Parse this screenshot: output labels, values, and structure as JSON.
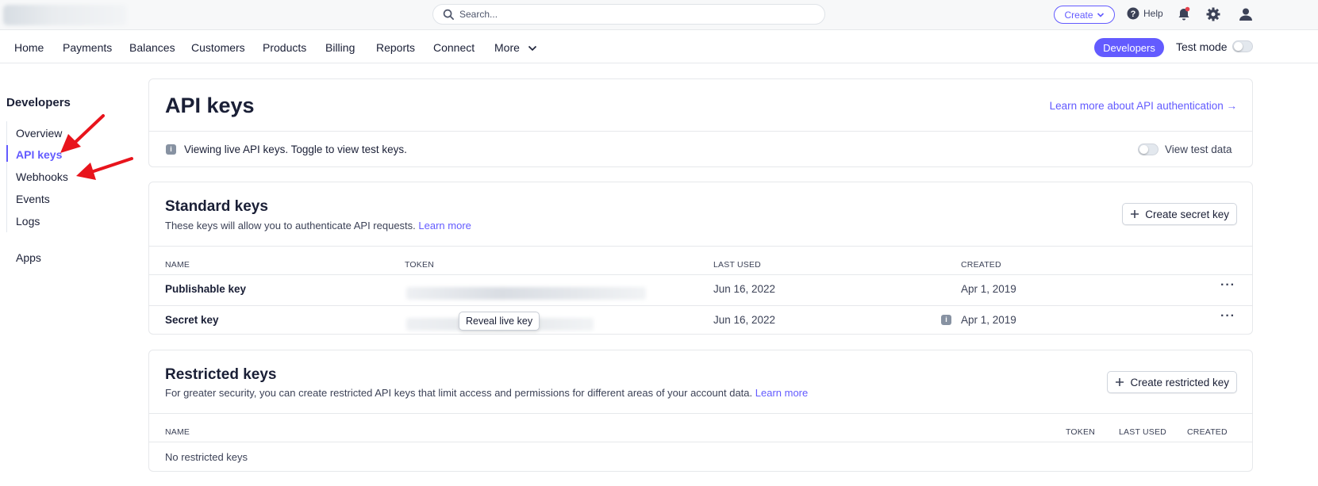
{
  "topbar": {
    "search_placeholder": "Search...",
    "create_label": "Create",
    "help_label": "Help"
  },
  "nav": {
    "items": [
      "Home",
      "Payments",
      "Balances",
      "Customers",
      "Products",
      "Billing",
      "Reports",
      "Connect",
      "More"
    ],
    "developers_label": "Developers",
    "test_mode_label": "Test mode"
  },
  "sidebar": {
    "title": "Developers",
    "items": [
      "Overview",
      "API keys",
      "Webhooks",
      "Events",
      "Logs"
    ],
    "apps_label": "Apps"
  },
  "page": {
    "title": "API keys",
    "learn_more_auth": "Learn more about API authentication →",
    "notice": "Viewing live API keys. Toggle to view test keys.",
    "view_test_data": "View test data"
  },
  "standard_keys": {
    "title": "Standard keys",
    "description": "These keys will allow you to authenticate API requests.",
    "learn_more": "Learn more",
    "create_button": "Create secret key",
    "columns": [
      "NAME",
      "TOKEN",
      "LAST USED",
      "CREATED"
    ],
    "rows": [
      {
        "name": "Publishable key",
        "last_used": "Jun 16, 2022",
        "created": "Apr 1, 2019"
      },
      {
        "name": "Secret key",
        "last_used": "Jun 16, 2022",
        "created": "Apr 1, 2019"
      }
    ],
    "reveal_label": "Reveal live key"
  },
  "restricted_keys": {
    "title": "Restricted keys",
    "description": "For greater security, you can create restricted API keys that limit access and permissions for different areas of your account data.",
    "learn_more": "Learn more",
    "create_button": "Create restricted key",
    "columns": [
      "NAME",
      "TOKEN",
      "LAST USED",
      "CREATED"
    ],
    "empty_text": "No restricted keys"
  },
  "colors": {
    "accent": "#635bff",
    "annotation_arrow": "#e8141c"
  }
}
